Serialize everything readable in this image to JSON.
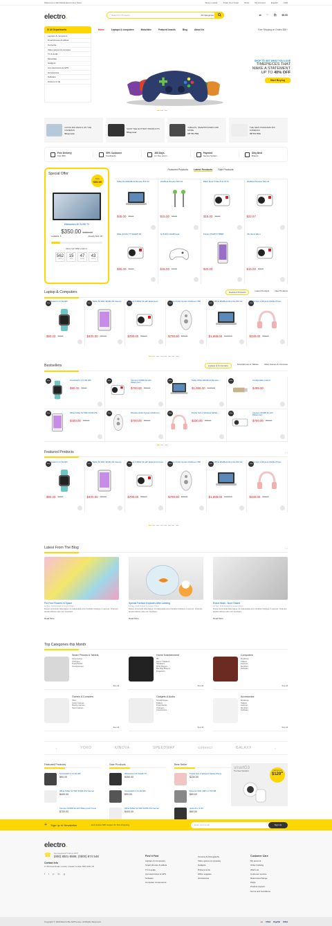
{
  "topbar": {
    "welcome": "Welcome to Worldwide Electronics Store",
    "store": "Store Locator",
    "track": "Track Your Order",
    "shop": "Shop",
    "account": "My Account",
    "lang": "English",
    "currency": "USD"
  },
  "header": {
    "logo": "electro",
    "logo_dot": ".",
    "search_placeholder": "Search for Products",
    "search_cat": "All Categories",
    "cart_total": "$0.00"
  },
  "nav": {
    "all_depts": "All Departments",
    "items": [
      "Home",
      "Laptops & computers",
      "Motorbike",
      "Featured brands",
      "Blog",
      "About Us"
    ],
    "shipping": "Free Shipping on Orders $50+"
  },
  "departments": [
    "Laptops & computers",
    "Smartphones & tablets",
    "Cameras",
    "Video games & consoles",
    "TV & audio",
    "Motorbike",
    "Gadgets",
    "Car electronics & GPS",
    "Accessories",
    "Software",
    "Printers & Ink"
  ],
  "hero": {
    "sub": "SHOP TO GET WHAT YOU LOVE",
    "line1": "TIMEPIECES THAT",
    "line2": "MAKE A STATEMENT",
    "line3a": "UP TO ",
    "line3b": "40% OFF",
    "btn": "Start Buying"
  },
  "promos": [
    {
      "t": "CATCH BIG DEALS ON THE CAMERAS",
      "l": "Shop now"
    },
    {
      "t": "SHOP THE HOTTEST PRODUCTS",
      "l": "Shop now"
    },
    {
      "t": "TABLETS, SMARTPHONES AND MORE",
      "l": "UP TO 70%"
    },
    {
      "t": "THE NEW STANDARD 360 CAMERAS",
      "l": "UP TO 70%"
    }
  ],
  "features": [
    {
      "b": "Free Delivery",
      "s": "from $50"
    },
    {
      "b": "99% Customer",
      "s": "Feedbacks"
    },
    {
      "b": "365 Days",
      "s": "for free return"
    },
    {
      "b": "Payment",
      "s": "Secure System"
    },
    {
      "b": "Only Best",
      "s": "Brands"
    }
  ],
  "special": {
    "title": "Special Offer",
    "save_lbl": "Save",
    "save_val": "$30.00",
    "name": "Widescreen 4K SUHD TV",
    "price": "$350.00",
    "old": "$450.00",
    "available": "Available: 6",
    "sold": "Already Sold: 28",
    "availability": 0.18,
    "hurry": "Hurry Up! Offer ends in:",
    "cd": [
      {
        "v": "562",
        "l": "DAYS"
      },
      {
        "v": "15",
        "l": "HRS"
      },
      {
        "v": "47",
        "l": "MINS"
      },
      {
        "v": "43",
        "l": "SECS"
      }
    ]
  },
  "tabs1": [
    "Featured Products",
    "Latest Products",
    "Sale Products"
  ],
  "latest": [
    {
      "nm": "Tablet Red EliteBook Revolve 810 G2",
      "p": "$45.00",
      "o": "$50.00"
    },
    {
      "nm": "EliteBook Revolve 810 G2",
      "p": "$15.00",
      "o": "$20.00"
    },
    {
      "nm": "Black Sport 5 Nike 5 W-TSTS",
      "p": "$15.00",
      "o": "$20.00"
    },
    {
      "nm": "EliteBook Revolve 810 G2",
      "p": "$22.57",
      "o": ""
    },
    {
      "nm": "iMate 94 Mini 7T SMART 94",
      "p": "$35.00",
      "o": "$40.00"
    },
    {
      "nm": "Air 8 Wi-Fi 64GB Gold",
      "p": "$15.00",
      "o": "$20.00"
    },
    {
      "nm": "Purple 3TS29T FTB58T",
      "p": "$20.00",
      "o": ""
    },
    {
      "nm": "Mini Wi-Fi WH-1",
      "p": "$15.00",
      "o": "$20.00"
    }
  ],
  "laptop_section": {
    "title": "Laptop & Computers",
    "tabs": [
      "Featured Products",
      "Latest Products",
      "New Products"
    ]
  },
  "laptop": [
    {
      "nm": "Smartwatch 2.0 LTE Wifi",
      "p": "$90.00",
      "o": "$99.00"
    },
    {
      "nm": "White Tablet S2 WiFi 32GB LTE Internet",
      "p": "$400.00",
      "o": "$450.00"
    },
    {
      "nm": "Camera C430W 4k with Waterproof Cover",
      "p": "$700.00",
      "o": "$800.00"
    },
    {
      "nm": "Wireless Audio System Multiroom 360",
      "p": "$700.00",
      "o": "$800.00"
    },
    {
      "nm": "Tablet White EliteBook Revolve 810 G2",
      "p": "$1,888.00",
      "o": "$2,000.00"
    },
    {
      "nm": "Purple Solo 2 Wireless Mobile Phone",
      "p": "$230.00",
      "o": "$250.00"
    }
  ],
  "best_section": {
    "title": "Bestsellers",
    "tabs": [
      "Laptops & Computers",
      "Smartphones & Tablets",
      "Video Games & Consoles"
    ]
  },
  "best": [
    {
      "nm": "Smartwatch 2.0 LTE Wifi",
      "p": "$90.00",
      "o": "$99.00"
    },
    {
      "nm": "Camera C430W 4k with Waterproof...",
      "p": "$700.00",
      "o": "$800.00"
    },
    {
      "nm": "Tablet White EliteBook Revolve...",
      "p": "$1,888.00",
      "o": "$2,000.00"
    },
    {
      "nm": "Configurable product",
      "p": "$499.00",
      "o": ""
    },
    {
      "nm": "White Tablet S2 WiFi 32GB LTE...",
      "p": "$400.00",
      "o": "$450.00"
    },
    {
      "nm": "Wireless Audio System Multiroom...",
      "p": "$700.00",
      "o": "$800.00"
    },
    {
      "nm": "Purple Solo 2 Wireless Mobile...",
      "p": "$230.00",
      "o": "$250.00"
    },
    {
      "nm": "Camera C430W 4k with Waterproof...",
      "p": "$700.00",
      "o": "$800.00"
    }
  ],
  "featured_section": {
    "title": "Featured Products"
  },
  "featured": [
    {
      "nm": "Smartwatch 2.0 LTE Wifi",
      "p": "$90.00",
      "o": "$99.00"
    },
    {
      "nm": "White Tablet S2 WiFi 32GB LTE Internet",
      "p": "$400.00",
      "o": "$450.00"
    },
    {
      "nm": "Camera C430W 4k with Waterproof cover",
      "p": "$700.00",
      "o": "$800.00"
    },
    {
      "nm": "Wireless Audio System Multiroom 360",
      "p": "$700.00",
      "o": "$800.00"
    },
    {
      "nm": "Tablet White EliteBook Revolve 810 G2",
      "p": "$1,888.00",
      "o": "$2,000.00"
    },
    {
      "nm": "Purple Solo 2 Wireless Mobile Phone",
      "p": "$230.00",
      "o": "$250.00"
    }
  ],
  "blog_section": {
    "title": "Latest From The Blog"
  },
  "blog": [
    {
      "t": "Pre Font Flowers In Space",
      "m": "14 Sep, 2016 Posted by Hoyen Pham",
      "x": "Donec commodo felis itaque mi malesuada arcu tincidunt tristique in sed est. Vivamus iaculis ultrices odio non hendrerit.",
      "r": "Read More"
    },
    {
      "t": "Special Fashion Explodes After Landing",
      "m": "14 Sep, 2016 Posted by Hoyen Pham",
      "x": "Donec commodo felis itaque mi malesuada arcu tincidunt tristique in sed est. Vivamus iaculis ultrices odio non hendrerit.",
      "r": "Read More"
    },
    {
      "t": "Robot Wars - Now Closed",
      "m": "14 Sep, 2016 Posted by Hoyen Pham",
      "x": "Donec commodo felis itaque mi malesuada arcu tincidunt tristique in sed est. Vivamus iaculis ultrices odio non hendrerit.",
      "r": "Read More"
    }
  ],
  "topcat_section": {
    "title": "Top Categories this Month"
  },
  "topcats": [
    {
      "t": "Smart Phones & Tablets",
      "l": [
        "Accessories",
        "Chargers",
        "Powerbanks",
        "Smartphones"
      ],
      "s": "See all"
    },
    {
      "t": "Home Entertainment",
      "l": [
        "3D",
        "Home Theaters",
        "Speakers",
        "DVD Players",
        "Blu-Ray Players",
        "Projectors"
      ],
      "s": "See all"
    },
    {
      "t": "Computers",
      "l": [
        "Desktops",
        "Tablets",
        "Laptops",
        "Monitors",
        "Software"
      ],
      "s": "See all"
    },
    {
      "t": "Games & Consoles",
      "l": [
        "Xbox",
        "Action Games",
        "Racing Games",
        "Sport Games"
      ],
      "s": "See all"
    },
    {
      "t": "Gadgets & Audio",
      "l": [
        "Smartphones",
        "Tablets",
        "Powerbanks",
        "Chargers",
        "Accessories"
      ],
      "s": "See all"
    },
    {
      "t": "Accessories",
      "l": [
        "Desktops",
        "Tablets",
        "Laptops",
        "Monitors",
        "Software"
      ],
      "s": "See all"
    }
  ],
  "brands": [
    "YOKO",
    "KINOVA",
    "SPEEDWAY",
    "coneect",
    "GALAXY"
  ],
  "mini": [
    {
      "title": "Featured Products",
      "items": [
        {
          "nm": "Smartwatch 2.0 LTE Wifi",
          "p": "$90.00"
        },
        {
          "nm": "White Tablet S2 WiFi 32GB LTE Internet",
          "p": "$400.00"
        },
        {
          "nm": "Camera C430W 4k with Water-proof Cover",
          "p": "$700.00"
        }
      ]
    },
    {
      "title": "Sale Products",
      "items": [
        {
          "nm": "Widescreen 4K SUHD TV",
          "p": "$350.00"
        },
        {
          "nm": "Smartwatch 2.0 LTE Wifi",
          "p": "$90.00"
        },
        {
          "nm": "White Tablet S2 WiFi 32GB LTE Internet",
          "p": "$400.00"
        }
      ]
    },
    {
      "title": "Best Seller",
      "items": [
        {
          "nm": "Purple Solo 2 Wireless Mobile Phone",
          "p": "$230.00"
        },
        {
          "nm": "External SSD USB 3.1 750 GB",
          "p": "$60.00"
        },
        {
          "nm": "Game E.L.S.O0",
          "p": "$60.00"
        }
      ]
    }
  ],
  "adv": {
    "brand": "smartG3",
    "sub": "The New Standard",
    "starting": "STARTING AT",
    "price": "$129",
    "cents": "99"
  },
  "newsletter": {
    "title": "Sign up to Newsletter",
    "sub": "...and receive $20 coupon for first shopping.",
    "placeholder": "Enter your email",
    "btn": "Sign Up"
  },
  "footer": {
    "logo": "electro",
    "question": "Got questions? Call us 24/7!",
    "phone": "(800) 8001-8588, (0600) 874 548",
    "contact_h": "Contact Info",
    "address": "17 Princess Road, London, Greater London NW1 8JR, UK",
    "col1": {
      "h": "Find It Fast",
      "l": [
        "Laptops & Computers",
        "Smart phones & tablets",
        "TV & audio",
        "Car electronics & GPS",
        "Software",
        "Computer components"
      ]
    },
    "col2": {
      "h": "",
      "l": [
        "Camera & photography",
        "Video games & consoles",
        "Gadgets",
        "Printers & ink",
        "Office supplies",
        "Accessories"
      ]
    },
    "col3": {
      "h": "Customer Care",
      "l": [
        "My account",
        "Order tracking",
        "Wish List",
        "Customer service",
        "Returns/exchange",
        "FAQs",
        "Product support",
        "Terms and Conditions"
      ]
    },
    "copy": "Copyright © 2020 Electro By AlitThemes. All Rights Reserved.",
    "pay": [
      "VISA",
      "PayPal",
      "VISA"
    ]
  }
}
